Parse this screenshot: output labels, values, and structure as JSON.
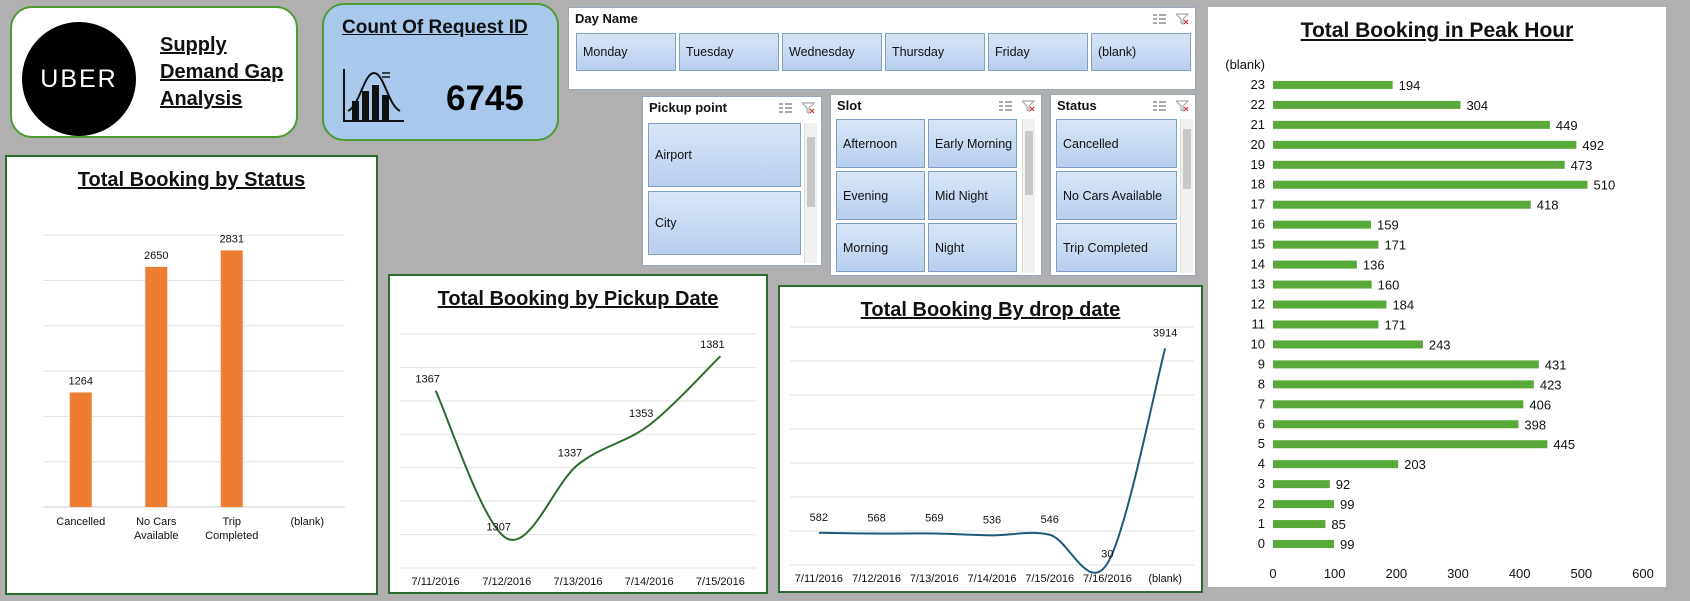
{
  "brand": {
    "logo": "UBER",
    "title": "Supply Demand Gap Analysis"
  },
  "kpi": {
    "title": "Count Of Request ID",
    "value": "6745",
    "icon": "bell-curve-bar-chart-icon"
  },
  "slicers": {
    "day": {
      "title": "Day Name",
      "items": [
        "Monday",
        "Tuesday",
        "Wednesday",
        "Thursday",
        "Friday",
        "(blank)"
      ]
    },
    "pickup": {
      "title": "Pickup point",
      "items": [
        "Airport",
        "City"
      ]
    },
    "slot": {
      "title": "Slot",
      "items": [
        "Afternoon",
        "Early Morning",
        "Evening",
        "Mid Night",
        "Morning",
        "Night"
      ]
    },
    "status": {
      "title": "Status",
      "items": [
        "Cancelled",
        "No Cars Available",
        "Trip Completed"
      ]
    }
  },
  "colors": {
    "orange": "#ed7d31",
    "green": "#59a83a",
    "darkgreen": "#2e6b2e",
    "blue": "#1f5a7a",
    "panel_border": "#2e6b2e"
  },
  "chart_data": [
    {
      "type": "bar",
      "title": "Total Booking  by Status",
      "categories": [
        "Cancelled",
        "No Cars Available",
        "Trip Completed",
        "(blank)"
      ],
      "values": [
        1264,
        2650,
        2831,
        null
      ],
      "ylim": [
        0,
        3200
      ],
      "grid": true
    },
    {
      "type": "line",
      "title": "Total Booking by  Pickup Date",
      "categories": [
        "7/11/2016",
        "7/12/2016",
        "7/13/2016",
        "7/14/2016",
        "7/15/2016"
      ],
      "values": [
        1367,
        1307,
        1337,
        1353,
        1381
      ],
      "ylim": [
        1295,
        1390
      ],
      "grid": true
    },
    {
      "type": "line",
      "title": "Total Booking By drop date",
      "categories": [
        "7/11/2016",
        "7/12/2016",
        "7/13/2016",
        "7/14/2016",
        "7/15/2016",
        "7/16/2016",
        "(blank)"
      ],
      "values": [
        582,
        568,
        569,
        536,
        546,
        30,
        3914
      ],
      "ylim": [
        0,
        4300
      ],
      "grid": true
    },
    {
      "type": "bar",
      "orientation": "horizontal",
      "title": "Total Booking in Peak Hour",
      "categories": [
        "(blank)",
        "23",
        "22",
        "21",
        "20",
        "19",
        "18",
        "17",
        "16",
        "15",
        "14",
        "13",
        "12",
        "11",
        "10",
        "9",
        "8",
        "7",
        "6",
        "5",
        "4",
        "3",
        "2",
        "1",
        "0"
      ],
      "values": [
        null,
        194,
        304,
        449,
        492,
        473,
        510,
        418,
        159,
        171,
        136,
        160,
        184,
        171,
        243,
        431,
        423,
        406,
        398,
        445,
        203,
        92,
        99,
        85,
        99
      ],
      "xlim": [
        0,
        600
      ],
      "xticks": [
        0,
        100,
        200,
        300,
        400,
        500,
        600
      ]
    }
  ]
}
